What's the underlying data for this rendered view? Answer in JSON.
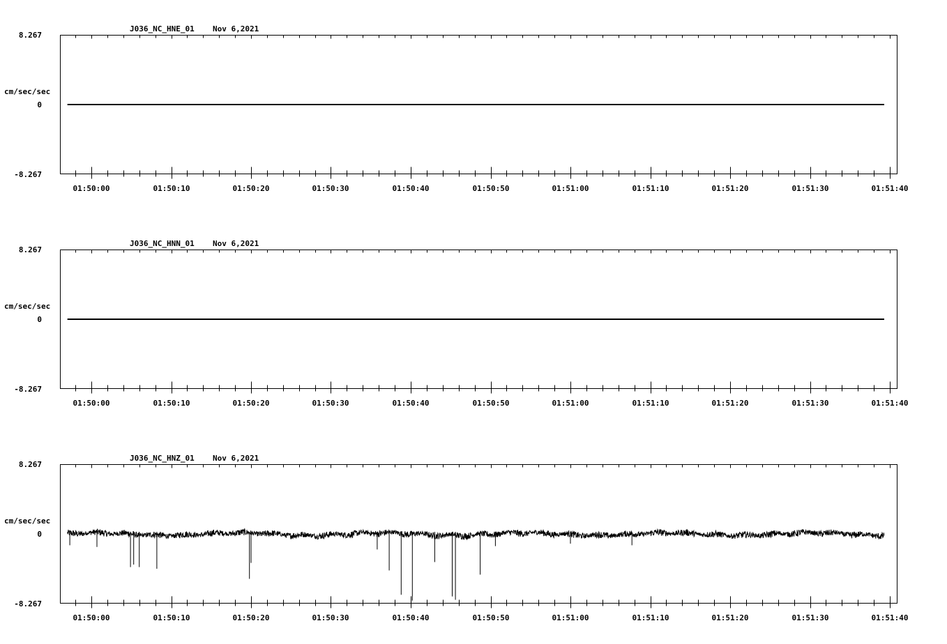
{
  "chart_data": [
    {
      "type": "line",
      "title": "J036_NC_HNE_01",
      "date": "Nov 6,2021",
      "ylabel": "cm/sec/sec",
      "ytick_labels": [
        "8.267",
        "0",
        "-8.267"
      ],
      "ylim": [
        -8.267,
        8.267
      ],
      "xlim_seconds_after_01_49_56": [
        0,
        104.7
      ],
      "xtick_labels": [
        "01:50:00",
        "01:50:10",
        "01:50:20",
        "01:50:30",
        "01:50:40",
        "01:50:50",
        "01:51:00",
        "01:51:10",
        "01:51:20",
        "01:51:30",
        "01:51:40"
      ],
      "grid": false,
      "series": [
        {
          "values": "flat near 0 (no visible signal)",
          "x": [
            1,
            103.3
          ],
          "y": [
            0,
            0
          ]
        }
      ]
    },
    {
      "type": "line",
      "title": "J036_NC_HNN_01",
      "date": "Nov 6,2021",
      "ylabel": "cm/sec/sec",
      "ytick_labels": [
        "8.267",
        "0",
        "-8.267"
      ],
      "ylim": [
        -8.267,
        8.267
      ],
      "xtick_labels": [
        "01:50:00",
        "01:50:10",
        "01:50:20",
        "01:50:30",
        "01:50:40",
        "01:50:50",
        "01:51:00",
        "01:51:10",
        "01:51:20",
        "01:51:30",
        "01:51:40"
      ],
      "grid": false,
      "series": [
        {
          "values": "flat near 0 (no visible signal)",
          "x": [
            1,
            103.3
          ],
          "y": [
            0,
            0
          ]
        }
      ]
    },
    {
      "type": "line",
      "title": "J036_NC_HNZ_01",
      "date": "Nov 6,2021",
      "ylabel": "cm/sec/sec",
      "ytick_labels": [
        "8.267",
        "0",
        "-8.267"
      ],
      "ylim": [
        -8.267,
        8.267
      ],
      "xtick_labels": [
        "01:50:00",
        "01:50:10",
        "01:50:20",
        "01:50:30",
        "01:50:40",
        "01:50:50",
        "01:51:00",
        "01:51:10",
        "01:51:20",
        "01:51:30",
        "01:51:40"
      ],
      "grid": false,
      "noise_amplitude": 0.45,
      "spikes": [
        {
          "x": 1.3,
          "y": -1.4
        },
        {
          "x": 4.7,
          "y": -1.6
        },
        {
          "x": 8.9,
          "y": -4.0
        },
        {
          "x": 9.3,
          "y": -3.7
        },
        {
          "x": 10.0,
          "y": -4.0
        },
        {
          "x": 12.2,
          "y": -4.2
        },
        {
          "x": 23.8,
          "y": -5.4
        },
        {
          "x": 24.0,
          "y": -3.5
        },
        {
          "x": 39.8,
          "y": -1.9
        },
        {
          "x": 41.3,
          "y": -4.4
        },
        {
          "x": 42.8,
          "y": -7.3
        },
        {
          "x": 44.2,
          "y": -8.0
        },
        {
          "x": 47.0,
          "y": -3.4
        },
        {
          "x": 49.2,
          "y": -7.5
        },
        {
          "x": 49.6,
          "y": -7.9
        },
        {
          "x": 52.7,
          "y": -4.9
        },
        {
          "x": 54.6,
          "y": -1.5
        },
        {
          "x": 64.0,
          "y": -1.2
        },
        {
          "x": 71.7,
          "y": -1.4
        }
      ]
    }
  ]
}
